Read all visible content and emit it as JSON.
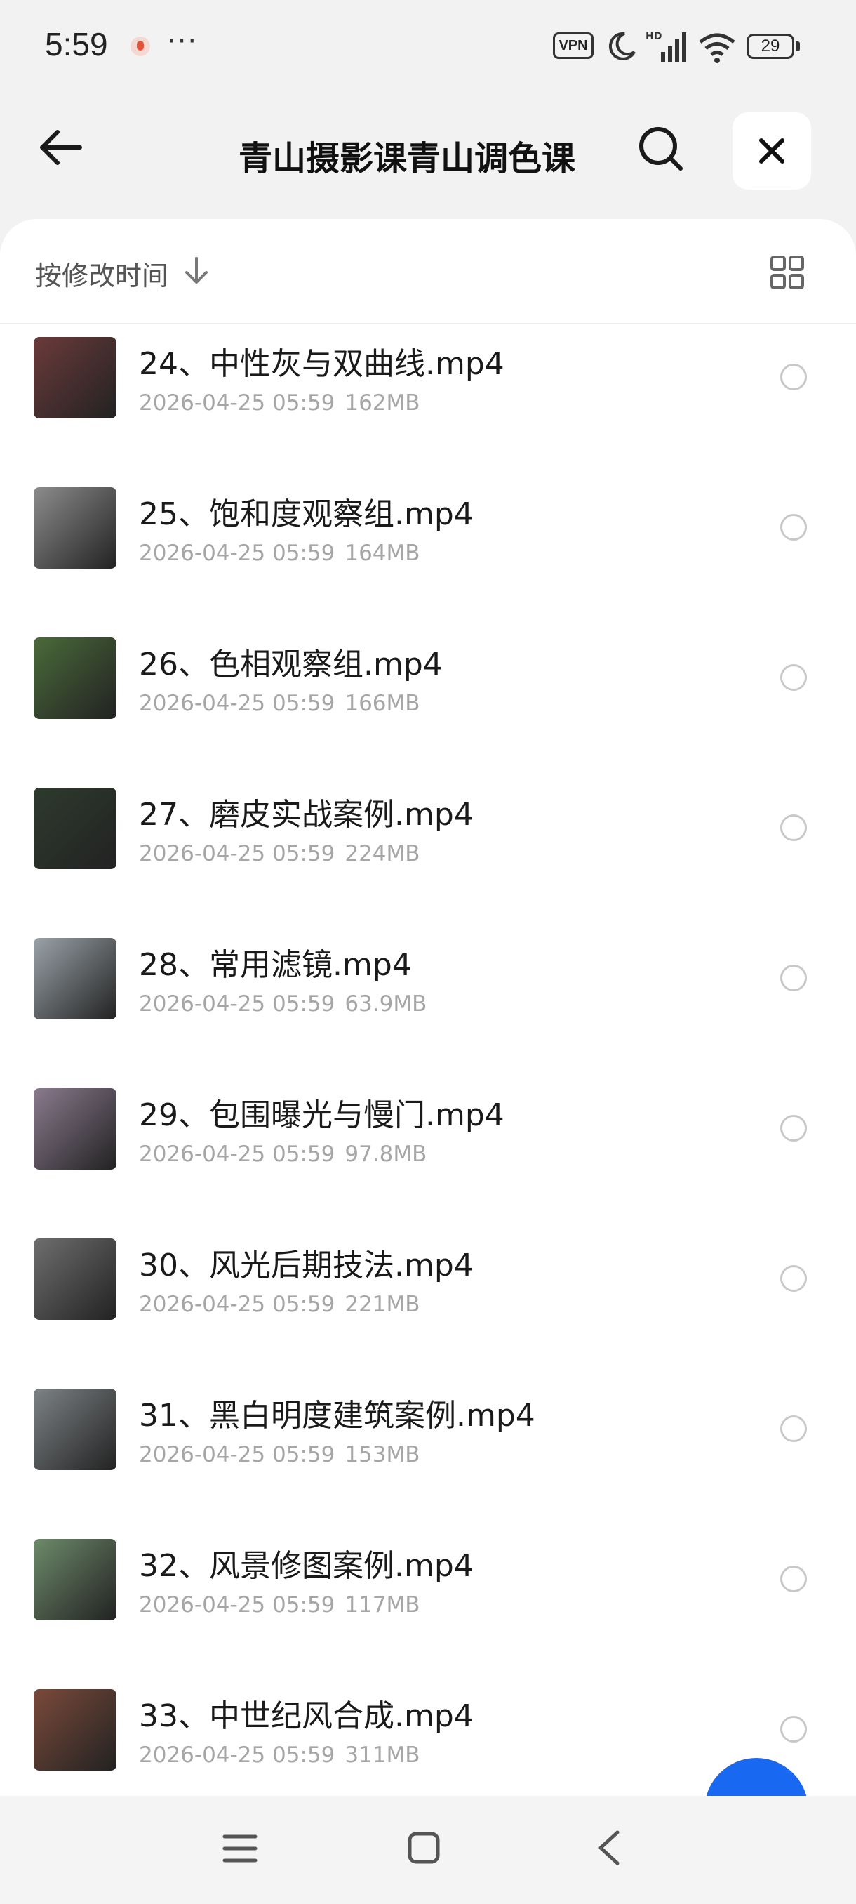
{
  "status_bar": {
    "time": "5:59",
    "more": "···",
    "vpn": "VPN",
    "battery": "29",
    "icons": [
      "app-notification-icon",
      "moon-icon",
      "hd-signal-icon",
      "wifi-icon",
      "battery-icon"
    ]
  },
  "header": {
    "title": "青山摄影课青山调色课",
    "icons": [
      "back-arrow-icon",
      "search-icon",
      "close-icon"
    ]
  },
  "sort": {
    "label": "按修改时间",
    "icons": [
      "arrow-down-icon",
      "grid-view-icon"
    ]
  },
  "files": [
    {
      "name": "24、中性灰与双曲线.mp4",
      "date": "2026-04-25 05:59",
      "size": "162MB",
      "thumb": "#6b3a3a"
    },
    {
      "name": "25、饱和度观察组.mp4",
      "date": "2026-04-25 05:59",
      "size": "164MB",
      "thumb": "#8c8c8c"
    },
    {
      "name": "26、色相观察组.mp4",
      "date": "2026-04-25 05:59",
      "size": "166MB",
      "thumb": "#4a6a3a"
    },
    {
      "name": "27、磨皮实战案例.mp4",
      "date": "2026-04-25 05:59",
      "size": "224MB",
      "thumb": "#2e3a2e"
    },
    {
      "name": "28、常用滤镜.mp4",
      "date": "2026-04-25 05:59",
      "size": "63.9MB",
      "thumb": "#9aa2a8"
    },
    {
      "name": "29、包围曝光与慢门.mp4",
      "date": "2026-04-25 05:59",
      "size": "97.8MB",
      "thumb": "#8a7a8e"
    },
    {
      "name": "30、风光后期技法.mp4",
      "date": "2026-04-25 05:59",
      "size": "221MB",
      "thumb": "#6e6e6e"
    },
    {
      "name": "31、黑白明度建筑案例.mp4",
      "date": "2026-04-25 05:59",
      "size": "153MB",
      "thumb": "#7d8285"
    },
    {
      "name": "32、风景修图案例.mp4",
      "date": "2026-04-25 05:59",
      "size": "117MB",
      "thumb": "#6d8a6a"
    },
    {
      "name": "33、中世纪风合成.mp4",
      "date": "2026-04-25 05:59",
      "size": "311MB",
      "thumb": "#7a4a3a"
    }
  ],
  "colors": {
    "fab": "#1868f2",
    "radio_border": "#c8c8c8"
  },
  "nav_bar": {
    "icons": [
      "menu-icon",
      "home-icon",
      "back-icon"
    ]
  }
}
